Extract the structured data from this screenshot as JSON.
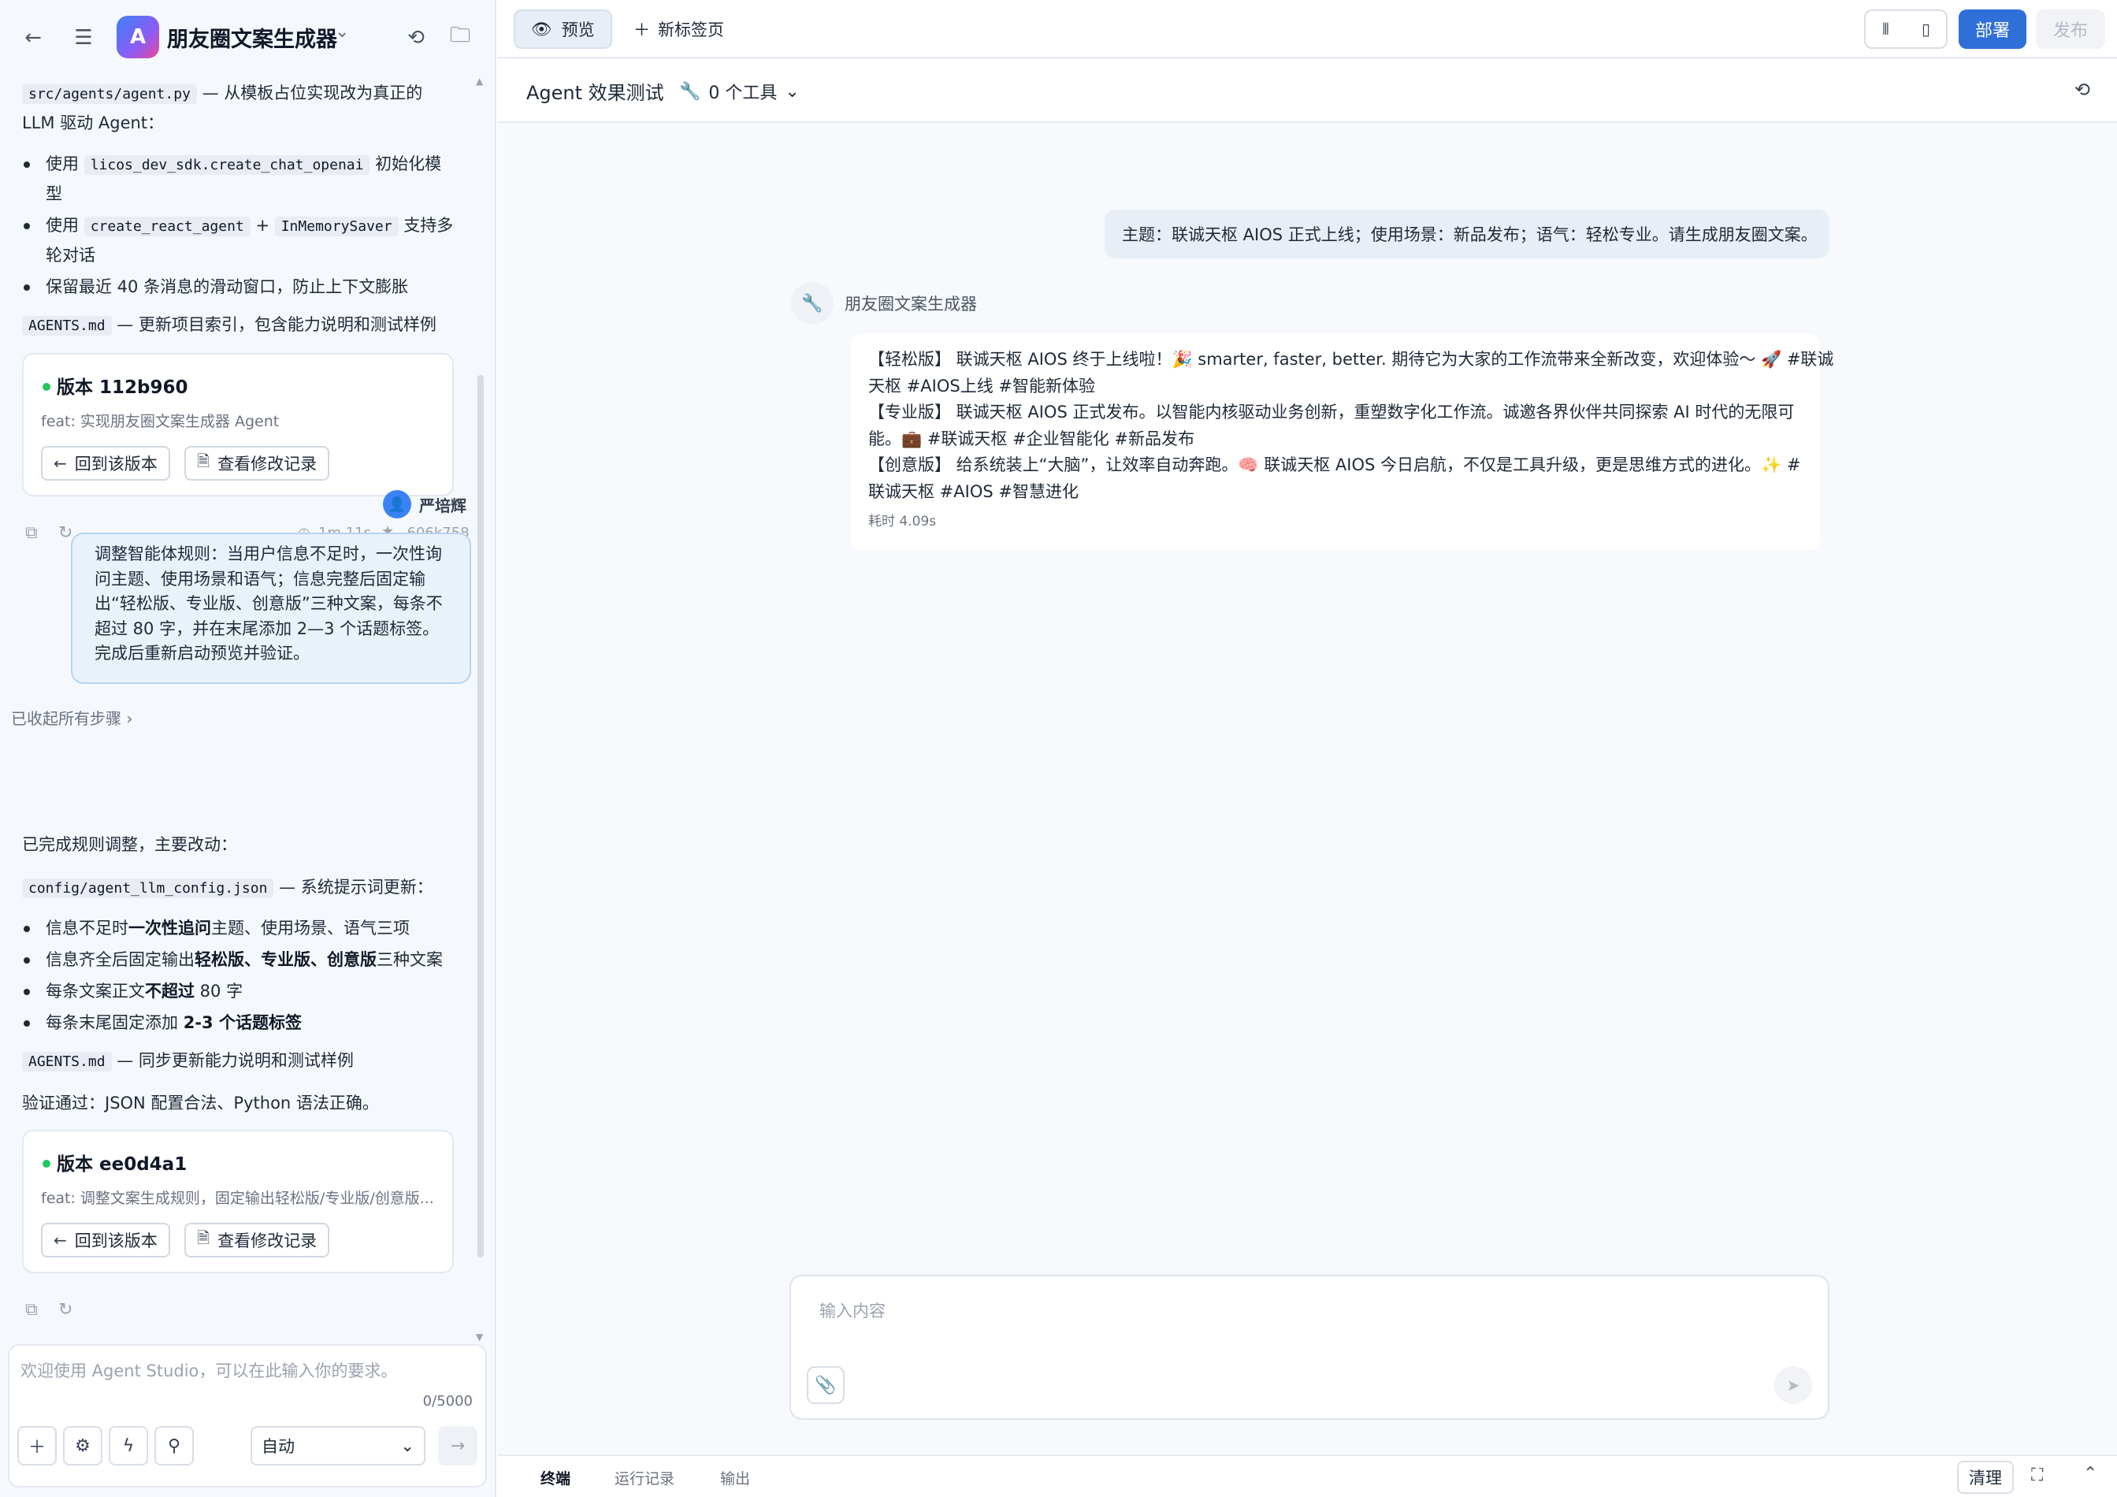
{
  "app": {
    "logo_letter": "A",
    "title": "朋友圈文案生成器"
  },
  "left_header_icons": [
    "back-arrow-icon",
    "menu-icon",
    "history-icon",
    "folder-icon"
  ],
  "chat": {
    "block1": {
      "agent_py_code": "src/agents/agent.py",
      "agent_py_text1": " — 从模板占位实现改为真正的",
      "agent_py_text2": "LLM 驱动 Agent：",
      "b1_pre": "使用 ",
      "b1_code": "licos_dev_sdk.create_chat_openai",
      "b1_post": " 初始化模",
      "b1_wrap": "型",
      "b2_pre": "使用 ",
      "b2_code1": "create_react_agent",
      "b2_mid": " + ",
      "b2_code2": "InMemorySaver",
      "b2_post": " 支持多",
      "b2_wrap": "轮对话",
      "b3": "保留最近 40 条消息的滑动窗口，防止上下文膨胀",
      "agents_md_code": "AGENTS.md",
      "agents_md_text": " — 更新项目索引，包含能力说明和测试样例"
    },
    "version1": {
      "title": "版本 112b960",
      "desc": "feat: 实现朋友圈文案生成器 Agent",
      "revert": "回到该版本",
      "history": "查看修改记录"
    },
    "meta1": {
      "duration": "1m 11s",
      "tokens": "-606k758"
    },
    "user": {
      "name": "严培辉",
      "message": "调整智能体规则：当用户信息不足时，一次性询问主题、使用场景和语气；信息完整后固定输出“轻松版、专业版、创意版”三种文案，每条不超过 80 字，并在末尾添加 2—3 个话题标签。完成后重新启动预览并验证。"
    },
    "collapsed_steps": "已收起所有步骤",
    "block2": {
      "intro": "已完成规则调整，主要改动：",
      "config_code": "config/agent_llm_config.json",
      "config_text": " — 系统提示词更新：",
      "c1_pre": "信息不足时",
      "c1_bold": "一次性追问",
      "c1_post": "主题、使用场景、语气三项",
      "c2_pre": "信息齐全后固定输出",
      "c2_bold": "轻松版、专业版、创意版",
      "c2_post": "三种文案",
      "c3_pre": "每条文案正文",
      "c3_bold": "不超过",
      "c3_post": " 80 字",
      "c4_pre": "每条末尾固定添加 ",
      "c4_bold": "2-3 个话题标签",
      "agents_md_code": "AGENTS.md",
      "agents_md_text": " — 同步更新能力说明和测试样例",
      "verify": "验证通过：JSON 配置合法、Python 语法正确。"
    },
    "version2": {
      "title": "版本 ee0d4a1",
      "desc": "feat: 调整文案生成规则，固定输出轻松版/专业版/创意版...",
      "revert": "回到该版本",
      "history": "查看修改记录"
    }
  },
  "composer": {
    "placeholder": "欢迎使用 Agent Studio，可以在此输入你的要求。",
    "count": "0/5000",
    "mode": "自动"
  },
  "tabs": {
    "preview": "预览",
    "new_tab": "新标签页",
    "deploy": "部署",
    "publish": "发布"
  },
  "test": {
    "title": "Agent 效果测试",
    "tools": "0 个工具"
  },
  "conversation": {
    "question": "主题：联诚天枢 AIOS 正式上线；使用场景：新品发布；语气：轻松专业。请生成朋友圈文案。",
    "bot_name": "朋友圈文案生成器",
    "answer_lines": [
      "【轻松版】 联诚天枢 AIOS 终于上线啦！🎉 smarter, faster, better. 期待它为大家的工作流带来全新改变，欢迎体验～ 🚀 #联诚",
      "天枢 #AIOS上线 #智能新体验",
      "【专业版】 联诚天枢 AIOS 正式发布。以智能内核驱动业务创新，重塑数字化工作流。诚邀各界伙伴共同探索 AI 时代的无限可",
      "能。💼 #联诚天枢 #企业智能化 #新品发布",
      "【创意版】 给系统装上“大脑”，让效率自动奔跑。🧠 联诚天枢 AIOS 今日启航，不仅是工具升级，更是思维方式的进化。✨ #",
      "联诚天枢 #AIOS #智慧进化"
    ],
    "elapsed": "耗时 4.09s"
  },
  "input": {
    "placeholder": "输入内容"
  },
  "bottom": {
    "terminal": "终端",
    "runs": "运行记录",
    "output": "输出",
    "clear": "清理"
  },
  "colors": {
    "accent": "#2f6fd8",
    "status_green": "#22c55e",
    "user_bubble": "#e9f1fb"
  }
}
